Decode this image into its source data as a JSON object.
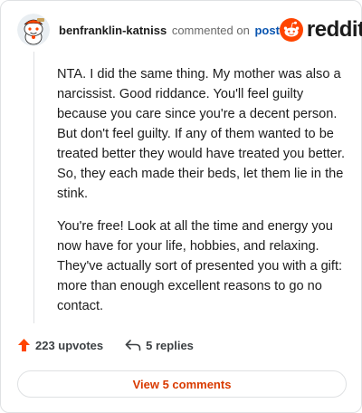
{
  "comment": {
    "username": "benfranklin-katniss",
    "commented_text": "commented on",
    "post_link": "post",
    "paragraphs": [
      "NTA. I did the same thing. My mother was also a narcissist. Good riddance. You'll feel guilty because you care since you're a decent person. But don't feel guilty. If any of them wanted to be treated better they would have treated you better. So, they each made their beds, let them lie in the stink.",
      "You're free! Look at all the time and energy you now have for your life, hobbies, and relaxing. They've actually sort of presented you with a gift: more than enough excellent reasons to go no contact."
    ]
  },
  "brand": {
    "name": "reddit",
    "color": "#ff4500"
  },
  "actions": {
    "upvotes": "223 upvotes",
    "replies": "5 replies"
  },
  "view_comments": "View 5 comments",
  "icons": {
    "avatar": "snoo-avatar-icon",
    "logo": "reddit-logo-icon",
    "upvote": "upvote-arrow-icon",
    "reply": "reply-arrow-icon"
  },
  "colors": {
    "upvote": "#ff4500",
    "link": "#0a55b0",
    "view_button": "#d93a00"
  }
}
